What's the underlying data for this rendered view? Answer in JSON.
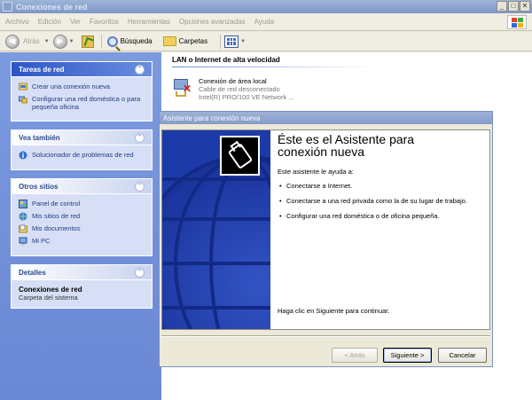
{
  "window": {
    "title": "Conexiones de red",
    "controls": [
      "_",
      "□",
      "✕"
    ]
  },
  "menu": [
    "Archivo",
    "Edición",
    "Ver",
    "Favoritos",
    "Herramientas",
    "Opciones avanzadas",
    "Ayuda"
  ],
  "toolbar": {
    "back": "Atrás",
    "search": "Búsqueda",
    "folders": "Carpetas"
  },
  "left_pane": {
    "tasks": {
      "title": "Tareas de red",
      "items": [
        "Crear una conexión nueva",
        "Configurar una red doméstica o para pequeña oficina"
      ]
    },
    "see_also": {
      "title": "Vea también",
      "items": [
        "Solucionador de problemas de red"
      ]
    },
    "other_places": {
      "title": "Otros sitios",
      "items": [
        "Panel de control",
        "Mis sitios de red",
        "Mis documentos",
        "Mi PC"
      ]
    },
    "details": {
      "title": "Detalles",
      "name": "Conexiones de red",
      "subtitle": "Carpeta del sistema"
    }
  },
  "main": {
    "group_title": "LAN o Internet de alta velocidad",
    "connection": {
      "name": "Conexión de área local",
      "status": "Cable de red desconectado",
      "device": "Intel(R) PRO/100 VE Network ..."
    }
  },
  "wizard": {
    "title": "Asistente para conexión nueva",
    "heading_line1": "Éste es el Asistente para",
    "heading_line2": "conexión nueva",
    "intro": "Este asistente le ayuda a:",
    "bullets": [
      "Conectarse a Internet.",
      "Conectarse a una red privada como la de su lugar de trabajo.",
      "Configurar una red doméstica o de oficina pequeña."
    ],
    "footer": "Haga clic en Siguiente para continuar.",
    "buttons": {
      "back": "< Atrás",
      "next": "Siguiente >",
      "cancel": "Cancelar"
    }
  }
}
